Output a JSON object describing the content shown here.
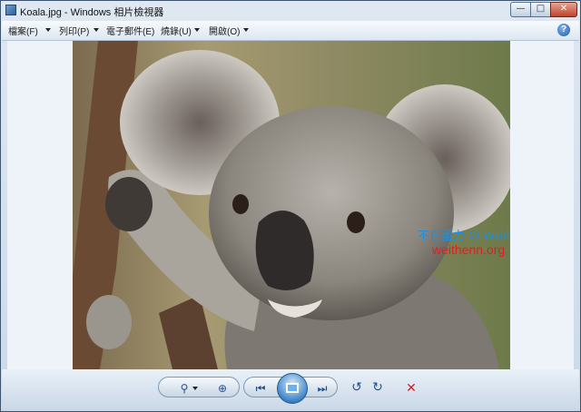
{
  "window": {
    "title": "Koala.jpg - Windows 相片檢視器",
    "minimize_glyph": "—",
    "maximize_glyph": "□",
    "close_glyph": "✕"
  },
  "menu": {
    "items": [
      {
        "label": "檔案(F)"
      },
      {
        "label": "列印(P)"
      },
      {
        "label": "電子郵件(E)"
      },
      {
        "label": "燒錄(U)"
      },
      {
        "label": "開啟(O)"
      }
    ],
    "help_glyph": "?"
  },
  "image": {
    "watermark_line1": "不自量力 の Weithenn",
    "watermark_line2": "weithenn.org"
  },
  "toolbar": {
    "zoom_glyph": "⚲",
    "fit_glyph": "⊕",
    "previous_glyph": "⏮",
    "next_glyph": "⏭",
    "rotate_ccw_glyph": "↺",
    "rotate_cw_glyph": "↻",
    "delete_glyph": "✕"
  },
  "icons": [
    "app-icon",
    "help-icon",
    "zoom-icon",
    "fit-window-icon",
    "previous-icon",
    "slideshow-icon",
    "next-icon",
    "rotate-counterclockwise-icon",
    "rotate-clockwise-icon",
    "delete-icon"
  ],
  "colors": {
    "watermark_blue": "#1f8fe0",
    "watermark_red": "#e0201f",
    "close_red": "#c0432a"
  }
}
